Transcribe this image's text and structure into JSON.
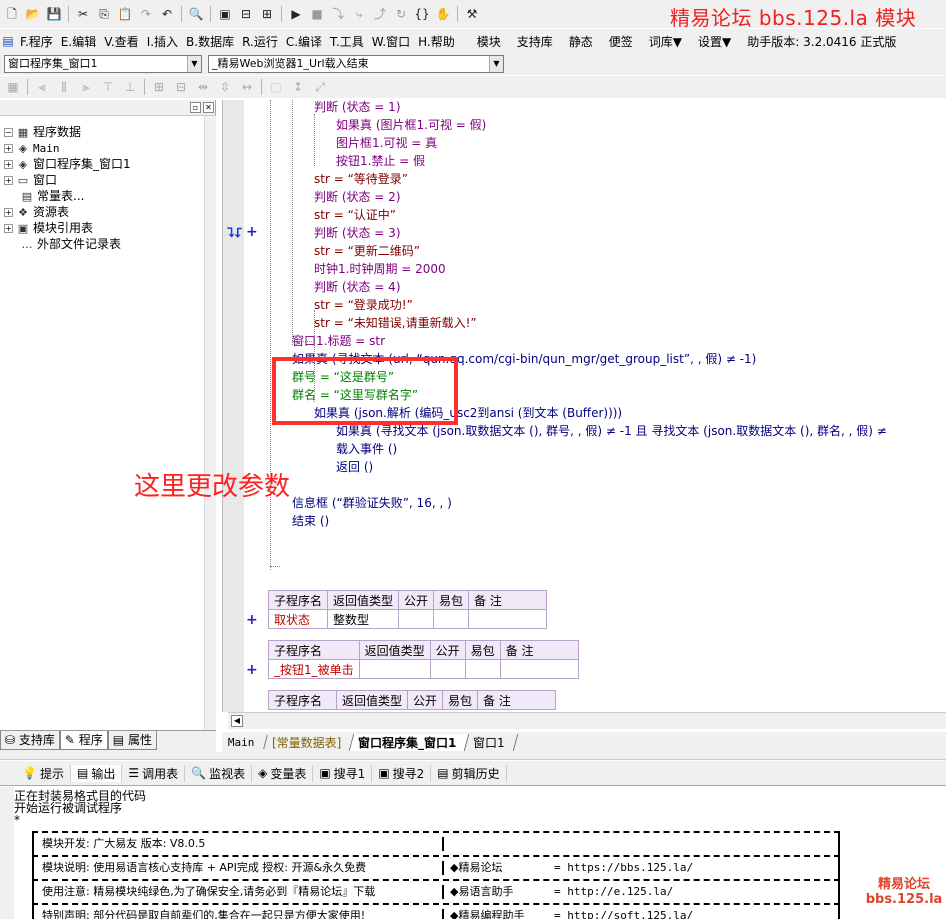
{
  "promo_banner": "精易论坛  bbs.125.la  模块",
  "toolbar": {
    "icons": [
      "new-file-icon",
      "open-folder-icon",
      "save-icon",
      "cut-icon",
      "copy-icon",
      "paste-icon",
      "redo-icon",
      "undo-icon",
      "find-icon",
      "layout1-icon",
      "layout2-icon",
      "layout3-icon",
      "run-icon",
      "stop-icon",
      "step-icon",
      "step-into-icon",
      "step-out-icon",
      "step-over-icon",
      "braces-icon",
      "hand-icon",
      "compile-icon"
    ]
  },
  "menu": [
    "F.程序",
    "E.编辑",
    "V.查看",
    "I.插入",
    "B.数据库",
    "R.运行",
    "C.编译",
    "T.工具",
    "W.窗口",
    "H.帮助",
    "模块",
    "支持库",
    "静态",
    "便签",
    "词库▼",
    "设置▼",
    "助手版本: 3.2.0416 正式版"
  ],
  "combos": {
    "left": "窗口程序集_窗口1",
    "right": "_精易Web浏览器1_Url载入结束"
  },
  "tree": [
    {
      "label": "程序数据",
      "icon": "▦"
    },
    {
      "label": "Main",
      "icon": "◈"
    },
    {
      "label": "窗口程序集_窗口1",
      "icon": "◈"
    },
    {
      "label": "窗口",
      "icon": "▭"
    },
    {
      "label": "常量表...",
      "icon": "▤"
    },
    {
      "label": "资源表",
      "icon": "❖"
    },
    {
      "label": "模块引用表",
      "icon": "▣"
    },
    {
      "label": "外部文件记录表",
      "icon": "…"
    }
  ],
  "left_tabs": [
    "支持库",
    "程序",
    "属性"
  ],
  "code": {
    "l1": "判断 (状态 = 1)",
    "l2": "如果真 (图片框1.可视 = 假)",
    "l3": "图片框1.可视 = 真",
    "l4": "按钮1.禁止 = 假",
    "l5": "str = “等待登录”",
    "l6": "判断 (状态 = 2)",
    "l7": "str = “认证中”",
    "l8": "判断 (状态 = 3)",
    "l9": "str = “更新二维码”",
    "l10": "时钟1.时钟周期 = 2000",
    "l11": "判断 (状态 = 4)",
    "l12": "str = “登录成功!”",
    "l13": "str = “未知错误,请重新载入!”",
    "l14": "窗口1.标题 = str",
    "l15": "如果真 (寻找文本 (url, “qun.qq.com/cgi-bin/qun_mgr/get_group_list”, , 假) ≠ -1)",
    "l16": "群号 = “这是群号”",
    "l17": "群名 = “这里写群名字”",
    "l18": "如果真 (json.解析 (编码_usc2到ansi (到文本 (Buffer))))",
    "l19": "如果真 (寻找文本 (json.取数据文本 (), 群号, , 假) ≠ -1 且 寻找文本 (json.取数据文本 (), 群名, , 假) ≠",
    "l20": "载入事件 ()",
    "l21": "返回 ()",
    "l22": "信息框 (“群验证失败”, 16, , )",
    "l23": "结束 ()"
  },
  "annotation": "这里更改参数",
  "sub_tables": [
    {
      "headers": [
        "子程序名",
        "返回值类型",
        "公开",
        "易包",
        "备 注"
      ],
      "row": [
        "取状态",
        "整数型",
        "",
        "",
        ""
      ]
    },
    {
      "headers": [
        "子程序名",
        "返回值类型",
        "公开",
        "易包",
        "备 注"
      ],
      "row": [
        "_按钮1_被单击",
        "",
        "",
        "",
        ""
      ]
    },
    {
      "headers": [
        "子程序名",
        "返回值类型",
        "公开",
        "易包",
        "备 注"
      ]
    }
  ],
  "editor_tabs": [
    "Main",
    "[常量数据表]",
    "窗口程序集_窗口1",
    "窗口1"
  ],
  "bottom_tabs": [
    "提示",
    "输出",
    "调用表",
    "监视表",
    "变量表",
    "搜寻1",
    "搜寻2",
    "剪辑历史"
  ],
  "output": {
    "line1": "正在封装易格式目的代码",
    "line2": "开始运行被调试程序",
    "line3": "*",
    "rows": [
      {
        "a": "模块开发: 广大易友    版本: V8.0.5",
        "b": "",
        "c": ""
      },
      {
        "a": "模块说明: 使用易语言核心支持库 + API完成      授权: 开源&永久免费",
        "b": "◆精易论坛",
        "c": "=  https://bbs.125.la/"
      },
      {
        "a": "使用注意: 精易模块纯绿色,为了确保安全,请务必到『精易论坛』下载",
        "b": "◆易语言助手",
        "c": "=  http://e.125.la/"
      },
      {
        "a": "特别声明: 部分代码是取自前辈们的,集合在一起只是方便大家使用!",
        "b": "◆精易编程助手",
        "c": "=  http://soft.125.la/"
      }
    ]
  },
  "watermark": {
    "line1": "精易论坛",
    "line2": "bbs.125.la"
  }
}
